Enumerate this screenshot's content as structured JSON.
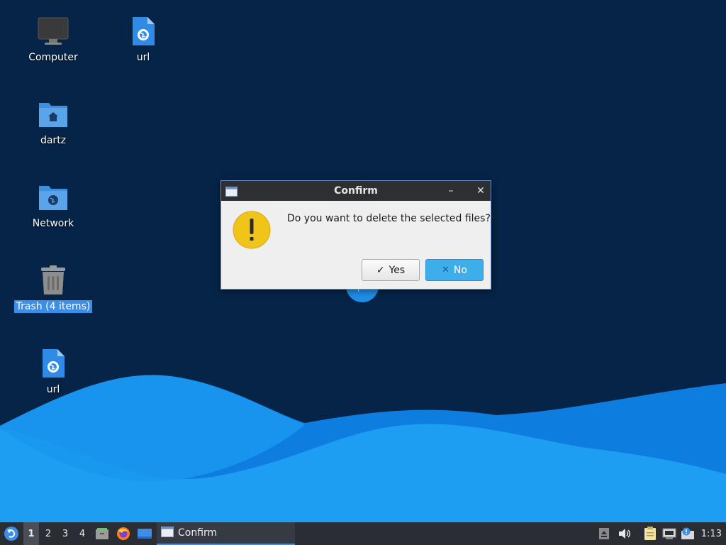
{
  "desktop": {
    "icons": [
      {
        "name": "computer",
        "label": "Computer",
        "icon": "monitor-icon"
      },
      {
        "name": "url-top",
        "label": "url",
        "icon": "web-file-icon"
      },
      {
        "name": "dartz",
        "label": "dartz",
        "icon": "home-folder-icon"
      },
      {
        "name": "network",
        "label": "Network",
        "icon": "network-folder-icon"
      },
      {
        "name": "trash",
        "label": "Trash (4 items)",
        "icon": "trash-icon",
        "selected": true
      },
      {
        "name": "url-bottom",
        "label": "url",
        "icon": "web-file-icon"
      }
    ]
  },
  "dialog": {
    "title": "Confirm",
    "message": "Do you want to delete the selected files?",
    "yes_label": "Yes",
    "no_label": "No",
    "minimize_symbol": "–",
    "close_symbol": "✕"
  },
  "taskbar": {
    "workspaces": [
      "1",
      "2",
      "3",
      "4"
    ],
    "active_workspace": "1",
    "launchers": [
      "file-manager-icon",
      "firefox-icon",
      "show-desktop-icon"
    ],
    "task_label": "Confirm",
    "tray": [
      "eject-icon",
      "volume-icon",
      "clipboard-icon",
      "network-icon",
      "update-notifier-icon"
    ],
    "clock": "1:13"
  },
  "colors": {
    "desktop_bg": "#052447",
    "wave_light": "#1a9bf0",
    "wave_dark": "#0a70d6",
    "accent": "#3daee9",
    "taskbar_bg": "#2a2d34"
  }
}
